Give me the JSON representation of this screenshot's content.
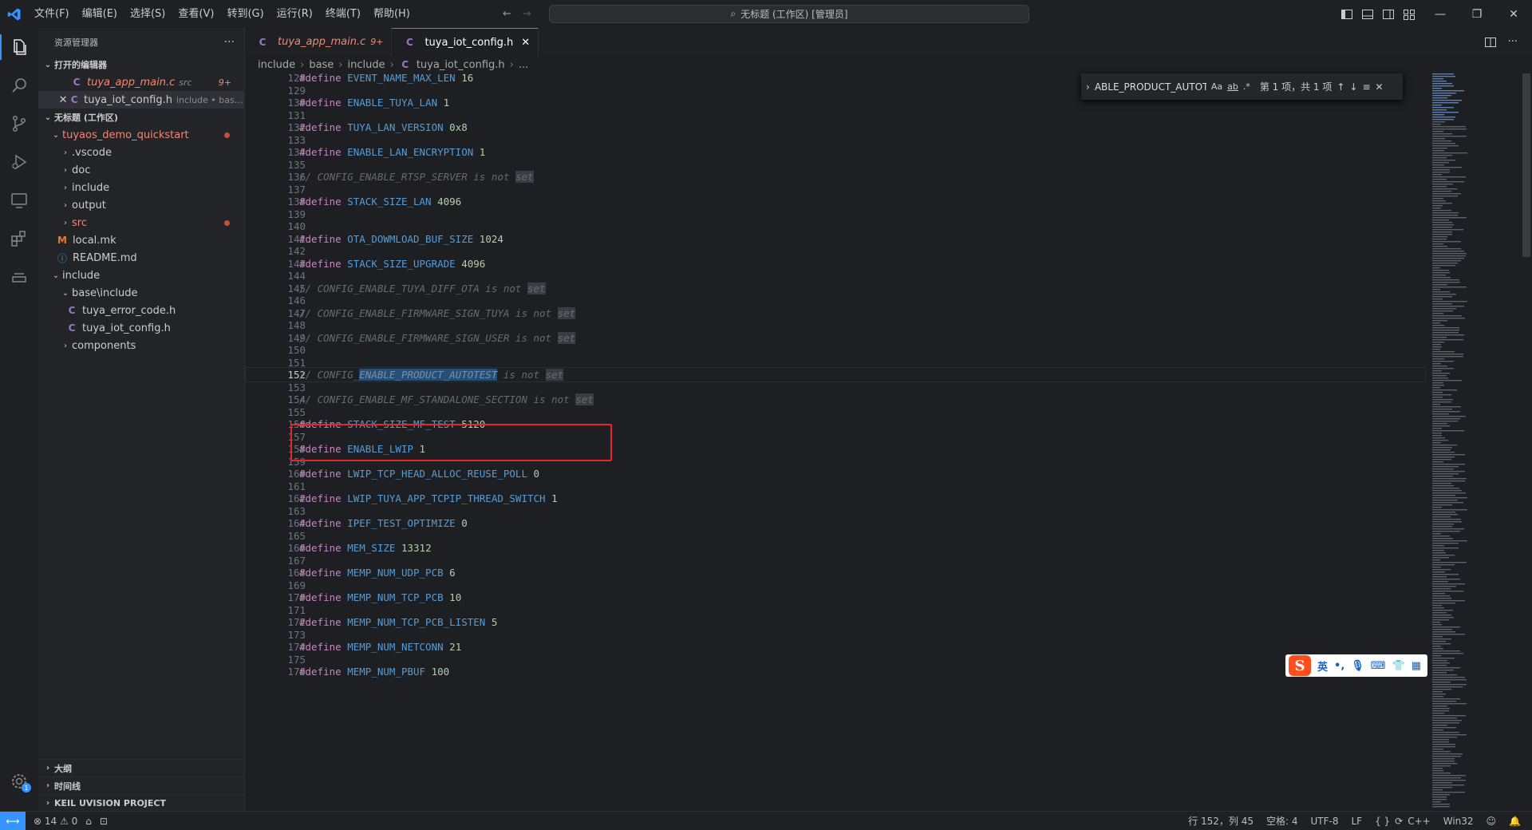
{
  "title_bar": {
    "menu": [
      "文件(F)",
      "编辑(E)",
      "选择(S)",
      "查看(V)",
      "转到(G)",
      "运行(R)",
      "终端(T)",
      "帮助(H)"
    ],
    "command_center": "无标题 (工作区) [管理员]"
  },
  "sidebar": {
    "title": "资源管理器",
    "open_editors": {
      "label": "打开的编辑器",
      "items": [
        {
          "name": "tuya_app_main.c",
          "detail": "src",
          "badge": "9+"
        },
        {
          "name": "tuya_iot_config.h",
          "detail": "include • base\\i..."
        }
      ]
    },
    "workspace": {
      "label": "无标题 (工作区)",
      "root": "tuyaos_demo_quickstart",
      "items": [
        ".vscode",
        "doc",
        "include",
        "output",
        "src",
        "local.mk",
        "README.md"
      ],
      "include_root": "include",
      "include_children": [
        "base\\include",
        "tuya_error_code.h",
        "tuya_iot_config.h",
        "components"
      ]
    },
    "bottom_sections": [
      "大纲",
      "时间线",
      "KEIL UVISION PROJECT"
    ]
  },
  "tabs": [
    {
      "name": "tuya_app_main.c",
      "badge": "9+"
    },
    {
      "name": "tuya_iot_config.h"
    }
  ],
  "breadcrumb": [
    "include",
    "base",
    "include",
    "tuya_iot_config.h",
    "..."
  ],
  "find_widget": {
    "query": "ABLE_PRODUCT_AUTOTE",
    "case_option": "Aa",
    "word_option": "ab",
    "regex_option": ".*",
    "result": "第 1 项，共 1 项"
  },
  "code_lines": [
    {
      "n": "128",
      "t": "define",
      "name": "EVENT_NAME_MAX_LEN",
      "val": "16"
    },
    {
      "n": "129",
      "t": "blank"
    },
    {
      "n": "130",
      "t": "define",
      "name": "ENABLE_TUYA_LAN",
      "val": "1"
    },
    {
      "n": "131",
      "t": "blank"
    },
    {
      "n": "132",
      "t": "define",
      "name": "TUYA_LAN_VERSION",
      "val": "0x8"
    },
    {
      "n": "133",
      "t": "blank"
    },
    {
      "n": "134",
      "t": "define",
      "name": "ENABLE_LAN_ENCRYPTION",
      "val": "1"
    },
    {
      "n": "135",
      "t": "blank"
    },
    {
      "n": "136",
      "t": "comment",
      "pre": "// CONFIG_ENABLE_RTSP_SERVER is not ",
      "post": "set"
    },
    {
      "n": "137",
      "t": "blank"
    },
    {
      "n": "138",
      "t": "define",
      "name": "STACK_SIZE_LAN",
      "val": "4096"
    },
    {
      "n": "139",
      "t": "blank"
    },
    {
      "n": "140",
      "t": "blank"
    },
    {
      "n": "141",
      "t": "define",
      "name": "OTA_DOWMLOAD_BUF_SIZE",
      "val": "1024"
    },
    {
      "n": "142",
      "t": "blank"
    },
    {
      "n": "143",
      "t": "define",
      "name": "STACK_SIZE_UPGRADE",
      "val": "4096"
    },
    {
      "n": "144",
      "t": "blank"
    },
    {
      "n": "145",
      "t": "comment",
      "pre": "// CONFIG_ENABLE_TUYA_DIFF_OTA is not ",
      "post": "set"
    },
    {
      "n": "146",
      "t": "blank"
    },
    {
      "n": "147",
      "t": "comment",
      "pre": "// CONFIG_ENABLE_FIRMWARE_SIGN_TUYA is not ",
      "post": "set"
    },
    {
      "n": "148",
      "t": "blank"
    },
    {
      "n": "149",
      "t": "comment",
      "pre": "// CONFIG_ENABLE_FIRMWARE_SIGN_USER is not ",
      "post": "set"
    },
    {
      "n": "150",
      "t": "blank"
    },
    {
      "n": "151",
      "t": "blank"
    },
    {
      "n": "152",
      "t": "match",
      "pre": "// CONFIG_",
      "match": "ENABLE_PRODUCT_AUTOTEST",
      "mid": " is not ",
      "post": "set"
    },
    {
      "n": "153",
      "t": "blank"
    },
    {
      "n": "154",
      "t": "comment",
      "pre": "// CONFIG_ENABLE_MF_STANDALONE_SECTION is not ",
      "post": "set"
    },
    {
      "n": "155",
      "t": "blank"
    },
    {
      "n": "156",
      "t": "define",
      "name": "STACK_SIZE_MF_TEST",
      "val": "5120"
    },
    {
      "n": "157",
      "t": "blank"
    },
    {
      "n": "158",
      "t": "define",
      "name": "ENABLE_LWIP",
      "val": "1"
    },
    {
      "n": "159",
      "t": "blank"
    },
    {
      "n": "160",
      "t": "define",
      "name": "LWIP_TCP_HEAD_ALLOC_REUSE_POLL",
      "val": "0"
    },
    {
      "n": "161",
      "t": "blank"
    },
    {
      "n": "162",
      "t": "define",
      "name": "LWIP_TUYA_APP_TCPIP_THREAD_SWITCH",
      "val": "1"
    },
    {
      "n": "163",
      "t": "blank"
    },
    {
      "n": "164",
      "t": "define",
      "name": "IPEF_TEST_OPTIMIZE",
      "val": "0"
    },
    {
      "n": "165",
      "t": "blank"
    },
    {
      "n": "166",
      "t": "define",
      "name": "MEM_SIZE",
      "val": "13312"
    },
    {
      "n": "167",
      "t": "blank"
    },
    {
      "n": "168",
      "t": "define",
      "name": "MEMP_NUM_UDP_PCB",
      "val": "6"
    },
    {
      "n": "169",
      "t": "blank"
    },
    {
      "n": "170",
      "t": "define",
      "name": "MEMP_NUM_TCP_PCB",
      "val": "10"
    },
    {
      "n": "171",
      "t": "blank"
    },
    {
      "n": "172",
      "t": "define",
      "name": "MEMP_NUM_TCP_PCB_LISTEN",
      "val": "5"
    },
    {
      "n": "173",
      "t": "blank"
    },
    {
      "n": "174",
      "t": "define",
      "name": "MEMP_NUM_NETCONN",
      "val": "21"
    },
    {
      "n": "175",
      "t": "blank"
    },
    {
      "n": "176",
      "t": "define",
      "name": "MEMP_NUM_PBUF",
      "val": "100"
    }
  ],
  "current_line": "152",
  "ime": {
    "lang": "英",
    "punct": "•,"
  },
  "status_bar": {
    "errors": "14",
    "warnings": "0",
    "position": "行 152，列 45",
    "spaces": "空格: 4",
    "encoding": "UTF-8",
    "eol": "LF",
    "language": "C++",
    "platform": "Win32",
    "braces": "{ }"
  },
  "colors": {
    "accent": "#3794ff",
    "annotation": "#e5262a",
    "modified": "#f48771"
  }
}
